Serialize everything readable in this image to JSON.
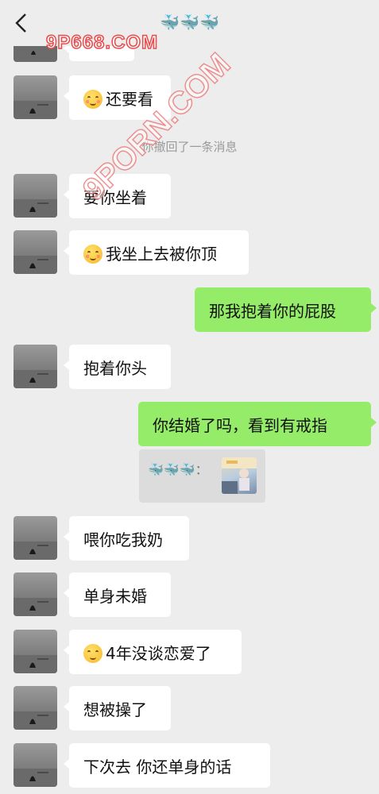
{
  "header": {
    "contact_name": "🐳🐳🐳"
  },
  "watermark": {
    "top": "9P668.COM",
    "diagonal": "9PORN.COM"
  },
  "messages": [
    {
      "side": "in",
      "emoji": true,
      "text": "还要看"
    },
    {
      "side": "system",
      "text": "你撤回了一条消息"
    },
    {
      "side": "in",
      "emoji": false,
      "text": "要你坐着"
    },
    {
      "side": "in",
      "emoji": true,
      "text": "我坐上去被你顶"
    },
    {
      "side": "out",
      "emoji": false,
      "text": "那我抱着你的屁股"
    },
    {
      "side": "in",
      "emoji": false,
      "text": "抱着你头"
    },
    {
      "side": "out",
      "emoji": false,
      "text": "你结婚了吗，看到有戒指"
    },
    {
      "side": "quote",
      "sender": "🐳🐳🐳："
    },
    {
      "side": "in",
      "emoji": false,
      "text": "喂你吃我奶"
    },
    {
      "side": "in",
      "emoji": false,
      "text": "单身未婚"
    },
    {
      "side": "in",
      "emoji": true,
      "text": "4年没谈恋爱了"
    },
    {
      "side": "in",
      "emoji": false,
      "text": "想被操了"
    },
    {
      "side": "in",
      "emoji": false,
      "text": "下次去 你还单身的话"
    }
  ]
}
